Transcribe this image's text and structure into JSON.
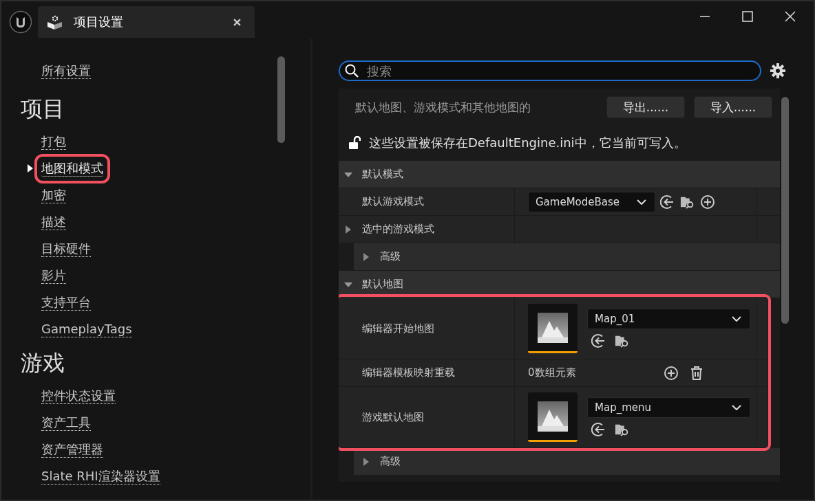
{
  "window": {
    "title": "项目设置"
  },
  "sidebar": {
    "all_settings": {
      "label": "所有设置",
      "selected": false,
      "highlighted": false
    },
    "groups": [
      {
        "heading": "项目",
        "items": [
          {
            "label": "打包",
            "selected": false,
            "highlighted": false
          },
          {
            "label": "地图和模式",
            "selected": true,
            "highlighted": true
          },
          {
            "label": "加密",
            "selected": false,
            "highlighted": false
          },
          {
            "label": "描述",
            "selected": false,
            "highlighted": false
          },
          {
            "label": "目标硬件",
            "selected": false,
            "highlighted": false
          },
          {
            "label": "影片",
            "selected": false,
            "highlighted": false
          },
          {
            "label": "支持平台",
            "selected": false,
            "highlighted": false
          },
          {
            "label": "GameplayTags",
            "selected": false,
            "highlighted": false
          }
        ]
      },
      {
        "heading": "游戏",
        "items": [
          {
            "label": "控件状态设置",
            "selected": false,
            "highlighted": false
          },
          {
            "label": "资产工具",
            "selected": false,
            "highlighted": false
          },
          {
            "label": "资产管理器",
            "selected": false,
            "highlighted": false
          },
          {
            "label": "Slate RHI渲染器设置",
            "selected": false,
            "highlighted": false
          }
        ]
      }
    ]
  },
  "details": {
    "search": {
      "placeholder": "搜索"
    },
    "description": "默认地图、游戏模式和其他地图的",
    "buttons": [
      "导出......",
      "导入......"
    ],
    "lock_note": "这些设置被保存在DefaultEngine.ini中，它当前可写入。",
    "sections": [
      {
        "title": "默认模式",
        "expanded": true,
        "rows": [
          {
            "kind": "class_picker",
            "label": "默认游戏模式",
            "value": "GameModeBase",
            "highlighted": false
          },
          {
            "kind": "category",
            "label": "选中的游戏模式",
            "expanded": false,
            "highlighted": false
          },
          {
            "kind": "subcategory",
            "label": "高级",
            "expanded": false,
            "highlighted": false
          }
        ]
      },
      {
        "title": "默认地图",
        "expanded": true,
        "rows": [
          {
            "kind": "asset_picker",
            "label": "编辑器开始地图",
            "value": "Map_01",
            "highlighted": true
          },
          {
            "kind": "array",
            "label": "编辑器模板映射重载",
            "value": "0数组元素",
            "highlighted": true
          },
          {
            "kind": "asset_picker",
            "label": "游戏默认地图",
            "value": "Map_menu",
            "highlighted": true
          },
          {
            "kind": "subcategory",
            "label": "高级",
            "expanded": false,
            "highlighted": false
          }
        ]
      }
    ]
  }
}
